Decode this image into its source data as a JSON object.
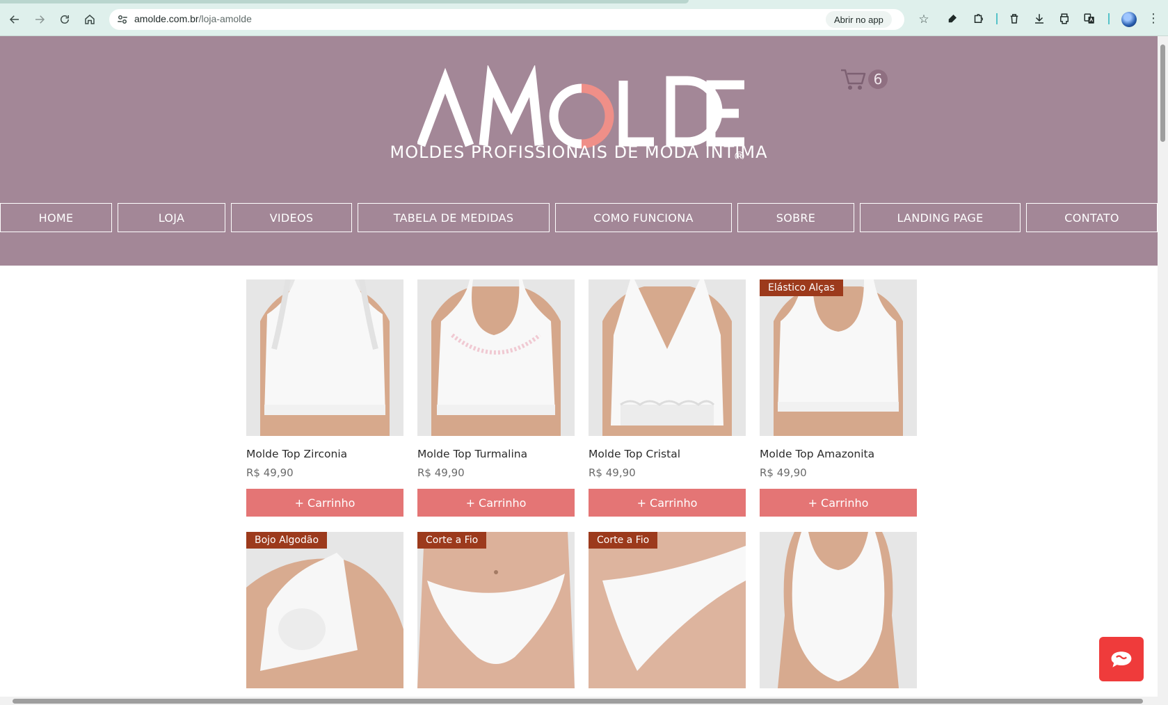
{
  "browser": {
    "url_domain": "amolde.com.br",
    "url_path": "/loja-amolde",
    "open_app_label": "Abrir no app"
  },
  "site": {
    "logo_text": "AMOLDE",
    "registered_mark": "®",
    "tagline": "MOLDES PROFISSIONAIS DE MODA ÍNTIMA",
    "cart_count": "6",
    "colors": {
      "header_bg": "#a38797",
      "button": "#e47575",
      "badge": "#9c3a1c",
      "logo_accent": "#ef8f88",
      "chat": "#ef3b3b"
    }
  },
  "menu": [
    {
      "label": "HOME"
    },
    {
      "label": "LOJA"
    },
    {
      "label": "VIDEOS"
    },
    {
      "label": "TABELA DE MEDIDAS"
    },
    {
      "label": "COMO FUNCIONA"
    },
    {
      "label": "SOBRE"
    },
    {
      "label": "LANDING PAGE"
    },
    {
      "label": "CONTATO"
    }
  ],
  "products": [
    {
      "name": "Molde Top Zirconia",
      "price": "R$ 49,90",
      "button": "+ Carrinho",
      "badge": ""
    },
    {
      "name": "Molde Top Turmalina",
      "price": "R$ 49,90",
      "button": "+ Carrinho",
      "badge": ""
    },
    {
      "name": "Molde Top Cristal",
      "price": "R$ 49,90",
      "button": "+ Carrinho",
      "badge": ""
    },
    {
      "name": "Molde Top Amazonita",
      "price": "R$ 49,90",
      "button": "+ Carrinho",
      "badge": "Elástico Alças"
    },
    {
      "badge": "Bojo Algodão"
    },
    {
      "badge": "Corte a Fio"
    },
    {
      "badge": "Corte a Fio"
    },
    {
      "badge": ""
    }
  ]
}
